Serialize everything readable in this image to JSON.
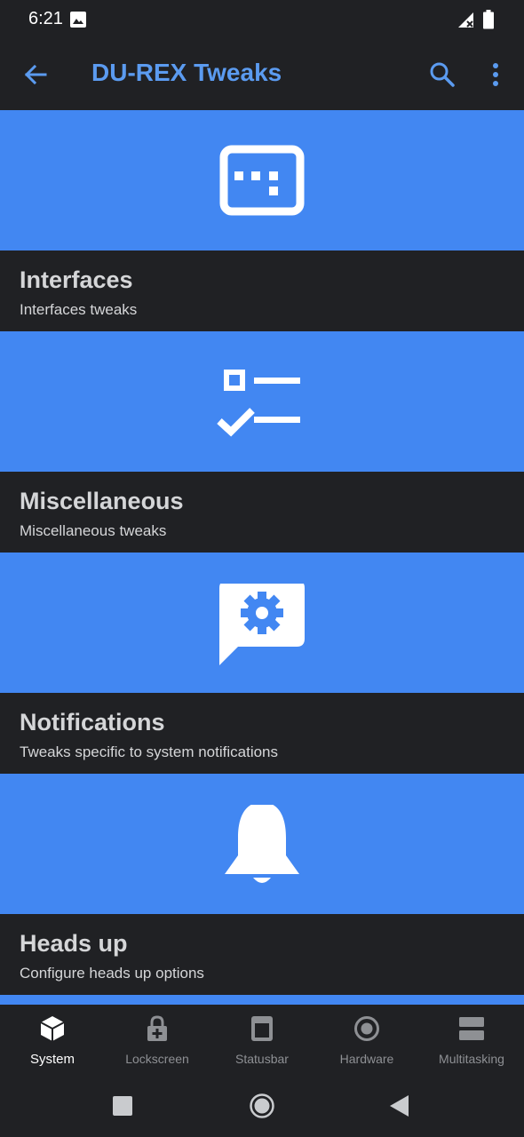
{
  "status_bar": {
    "time": "6:21",
    "icons": [
      "image-icon",
      "signal-off-icon",
      "battery-icon"
    ]
  },
  "app_bar": {
    "title": "DU-REX Tweaks",
    "title_color": "#5b9bf0",
    "icons": [
      "back-arrow-icon",
      "search-icon",
      "more-vert-icon"
    ]
  },
  "cards": [
    {
      "title": "Interfaces",
      "subtitle": "Interfaces tweaks",
      "icon": "dialpad-window-icon"
    },
    {
      "title": "Miscellaneous",
      "subtitle": "Miscellaneous tweaks",
      "icon": "checklist-icon"
    },
    {
      "title": "Notifications",
      "subtitle": "Tweaks specific to system notifications",
      "icon": "settings-chat-icon"
    },
    {
      "title": "Heads up",
      "subtitle": "Configure heads up options",
      "icon": "bell-icon"
    }
  ],
  "bottom_nav": {
    "items": [
      {
        "label": "System",
        "icon": "cube-icon",
        "active": true
      },
      {
        "label": "Lockscreen",
        "icon": "lock-plus-icon",
        "active": false
      },
      {
        "label": "Statusbar",
        "icon": "phone-statusbar-icon",
        "active": false
      },
      {
        "label": "Hardware",
        "icon": "radio-target-icon",
        "active": false
      },
      {
        "label": "Multitasking",
        "icon": "split-panels-icon",
        "active": false
      }
    ]
  },
  "system_nav": {
    "icons": [
      "recents-square-icon",
      "home-circle-icon",
      "back-triangle-icon"
    ]
  },
  "colors": {
    "accent": "#4287f2",
    "background": "#202124",
    "text": "#d5d6d8",
    "inactive": "#8e9094"
  }
}
